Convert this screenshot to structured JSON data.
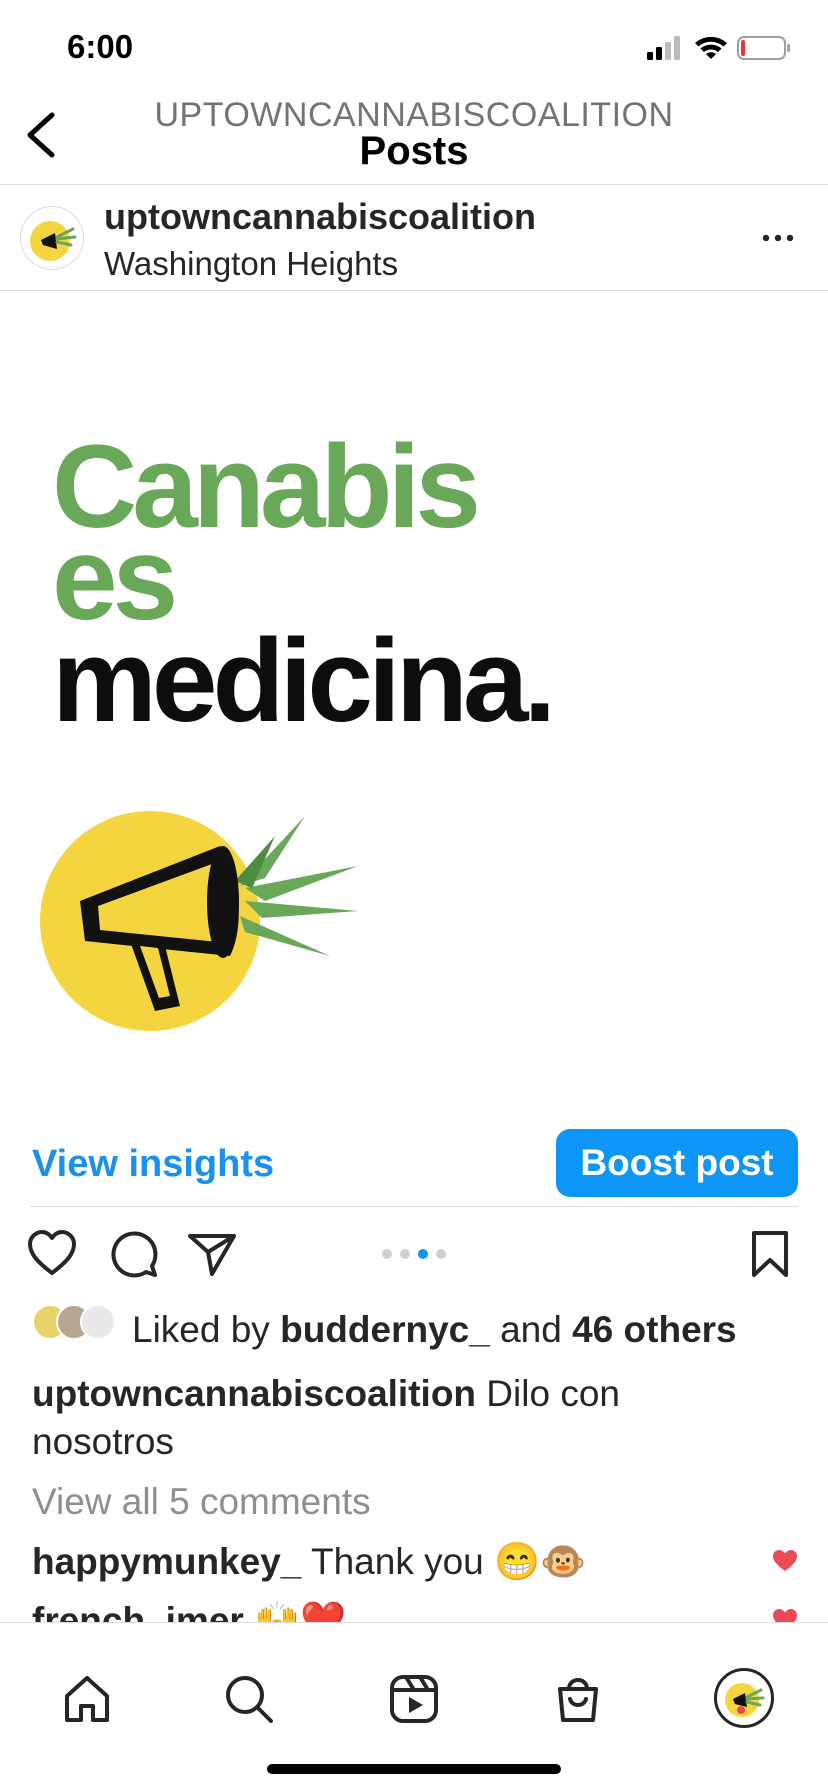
{
  "status_bar": {
    "time": "6:00"
  },
  "header": {
    "username": "UPTOWNCANNABISCOALITION",
    "title": "Posts"
  },
  "post": {
    "username": "uptowncannabiscoalition",
    "location": "Washington Heights",
    "image_text": {
      "line1": "Canabis",
      "line2": "es",
      "line3": "medicina."
    },
    "carousel": {
      "count": 4,
      "active_index": 2
    }
  },
  "insights": {
    "view_insights_label": "View insights",
    "boost_label": "Boost post"
  },
  "likes": {
    "prefix": "Liked by ",
    "user": "buddernyc_",
    "middle": " and ",
    "others": "46 others"
  },
  "caption": {
    "username": "uptowncannabiscoalition",
    "text": " Dilo con nosotros"
  },
  "view_all_comments": "View all 5 comments",
  "comments": [
    {
      "username": "happymunkey_",
      "text": " Thank you 😁🐵"
    },
    {
      "username": "french_jmer",
      "text": " 🙌❤️"
    }
  ],
  "colors": {
    "accent": "#0d96f6",
    "brand_green": "#68a858",
    "brand_yellow": "#f5d53f",
    "like_red": "#ed4956"
  },
  "icons": {
    "status": [
      "signal-icon",
      "wifi-icon",
      "battery-icon"
    ],
    "actions": [
      "heart-icon",
      "comment-icon",
      "share-icon",
      "bookmark-icon"
    ],
    "tabs": [
      "home-icon",
      "search-icon",
      "reels-icon",
      "shop-icon",
      "profile-icon"
    ]
  }
}
